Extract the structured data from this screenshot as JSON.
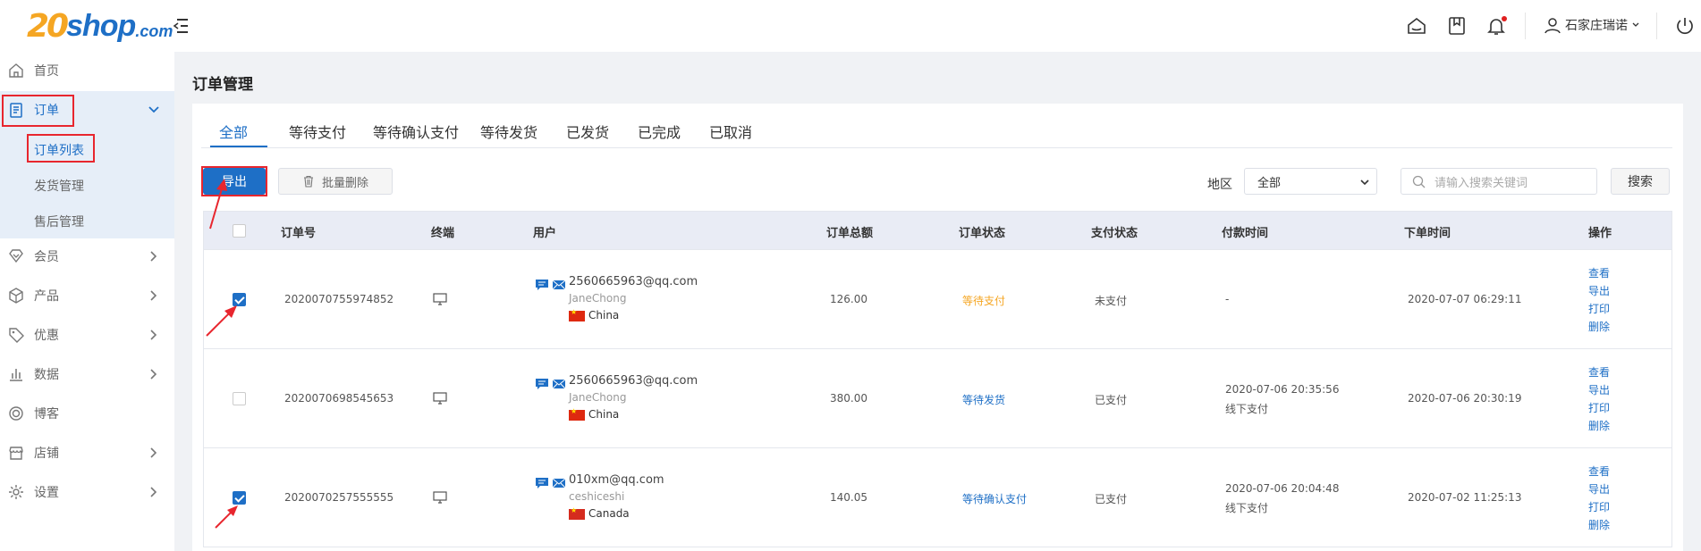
{
  "brand": {
    "logo_num": "20",
    "logo_shop": "shop",
    "logo_com": ".com",
    "accent": "#1e6fc6",
    "logo_orange": "#f5a623"
  },
  "header": {
    "icons": [
      "home-icon",
      "bookmark-icon",
      "bell-icon",
      "user-icon",
      "power-icon"
    ],
    "user_name": "石家庄瑞诺"
  },
  "sidebar": {
    "items": [
      {
        "label": "首页",
        "icon": "home-icon"
      },
      {
        "label": "订单",
        "icon": "clipboard-icon"
      },
      {
        "label": "会员",
        "icon": "diamond-icon"
      },
      {
        "label": "产品",
        "icon": "box-icon"
      },
      {
        "label": "优惠",
        "icon": "tag-icon"
      },
      {
        "label": "数据",
        "icon": "bar-chart-icon"
      },
      {
        "label": "博客",
        "icon": "target-icon"
      },
      {
        "label": "店铺",
        "icon": "store-icon"
      },
      {
        "label": "设置",
        "icon": "gear-icon"
      }
    ],
    "order_sub": [
      "订单列表",
      "发货管理",
      "售后管理"
    ]
  },
  "page": {
    "title": "订单管理",
    "tabs": [
      "全部",
      "等待支付",
      "等待确认支付",
      "等待发货",
      "已发货",
      "已完成",
      "已取消"
    ],
    "active_tab": "全部"
  },
  "toolbar": {
    "export_label": "导出",
    "bulk_delete_label": "批量删除",
    "region_label": "地区",
    "region_value": "全部",
    "search_placeholder": "请输入搜索关键词",
    "search_label": "搜索"
  },
  "table": {
    "headers": [
      "订单号",
      "终端",
      "用户",
      "订单总额",
      "订单状态",
      "支付状态",
      "付款时间",
      "下单时间",
      "操作"
    ],
    "ops": [
      "查看",
      "导出",
      "打印",
      "删除"
    ],
    "rows": [
      {
        "checked": true,
        "order_no": "2020070755974852",
        "email": "2560665963@qq.com",
        "uname": "JaneChong",
        "country": "China",
        "total": "126.00",
        "order_status": "等待支付",
        "status_color": "orange",
        "pay_status": "未支付",
        "pay_time": "-",
        "pay_method": "",
        "order_time": "2020-07-07 06:29:11"
      },
      {
        "checked": false,
        "order_no": "2020070698545653",
        "email": "2560665963@qq.com",
        "uname": "JaneChong",
        "country": "China",
        "total": "380.00",
        "order_status": "等待发货",
        "status_color": "blue",
        "pay_status": "已支付",
        "pay_time": "2020-07-06 20:35:56",
        "pay_method": "线下支付",
        "order_time": "2020-07-06 20:30:19"
      },
      {
        "checked": true,
        "order_no": "2020070257555555",
        "email": "010xm@qq.com",
        "uname": "ceshiceshi",
        "country": "Canada",
        "total": "140.05",
        "order_status": "等待确认支付",
        "status_color": "blue",
        "pay_status": "已支付",
        "pay_time": "2020-07-06 20:04:48",
        "pay_method": "线下支付",
        "order_time": "2020-07-02 11:25:13"
      }
    ]
  }
}
